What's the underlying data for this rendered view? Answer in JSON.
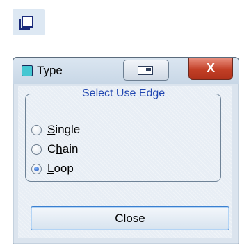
{
  "toolbar": {
    "icon": "window-square-icon"
  },
  "window": {
    "title": "Type",
    "title_icon": "app-icon",
    "controls": {
      "restore": "restore-icon",
      "close": "X"
    }
  },
  "group": {
    "legend": "Select Use Edge",
    "options": [
      {
        "pre": "",
        "mnemonic": "S",
        "post": "ingle",
        "checked": false
      },
      {
        "pre": "C",
        "mnemonic": "h",
        "post": "ain",
        "checked": false
      },
      {
        "pre": "",
        "mnemonic": "L",
        "post": "oop",
        "checked": true
      }
    ]
  },
  "buttons": {
    "close": {
      "pre": "",
      "mnemonic": "C",
      "post": "lose"
    }
  },
  "colors": {
    "legend": "#1f45b0",
    "close_button": "#c23f26"
  }
}
